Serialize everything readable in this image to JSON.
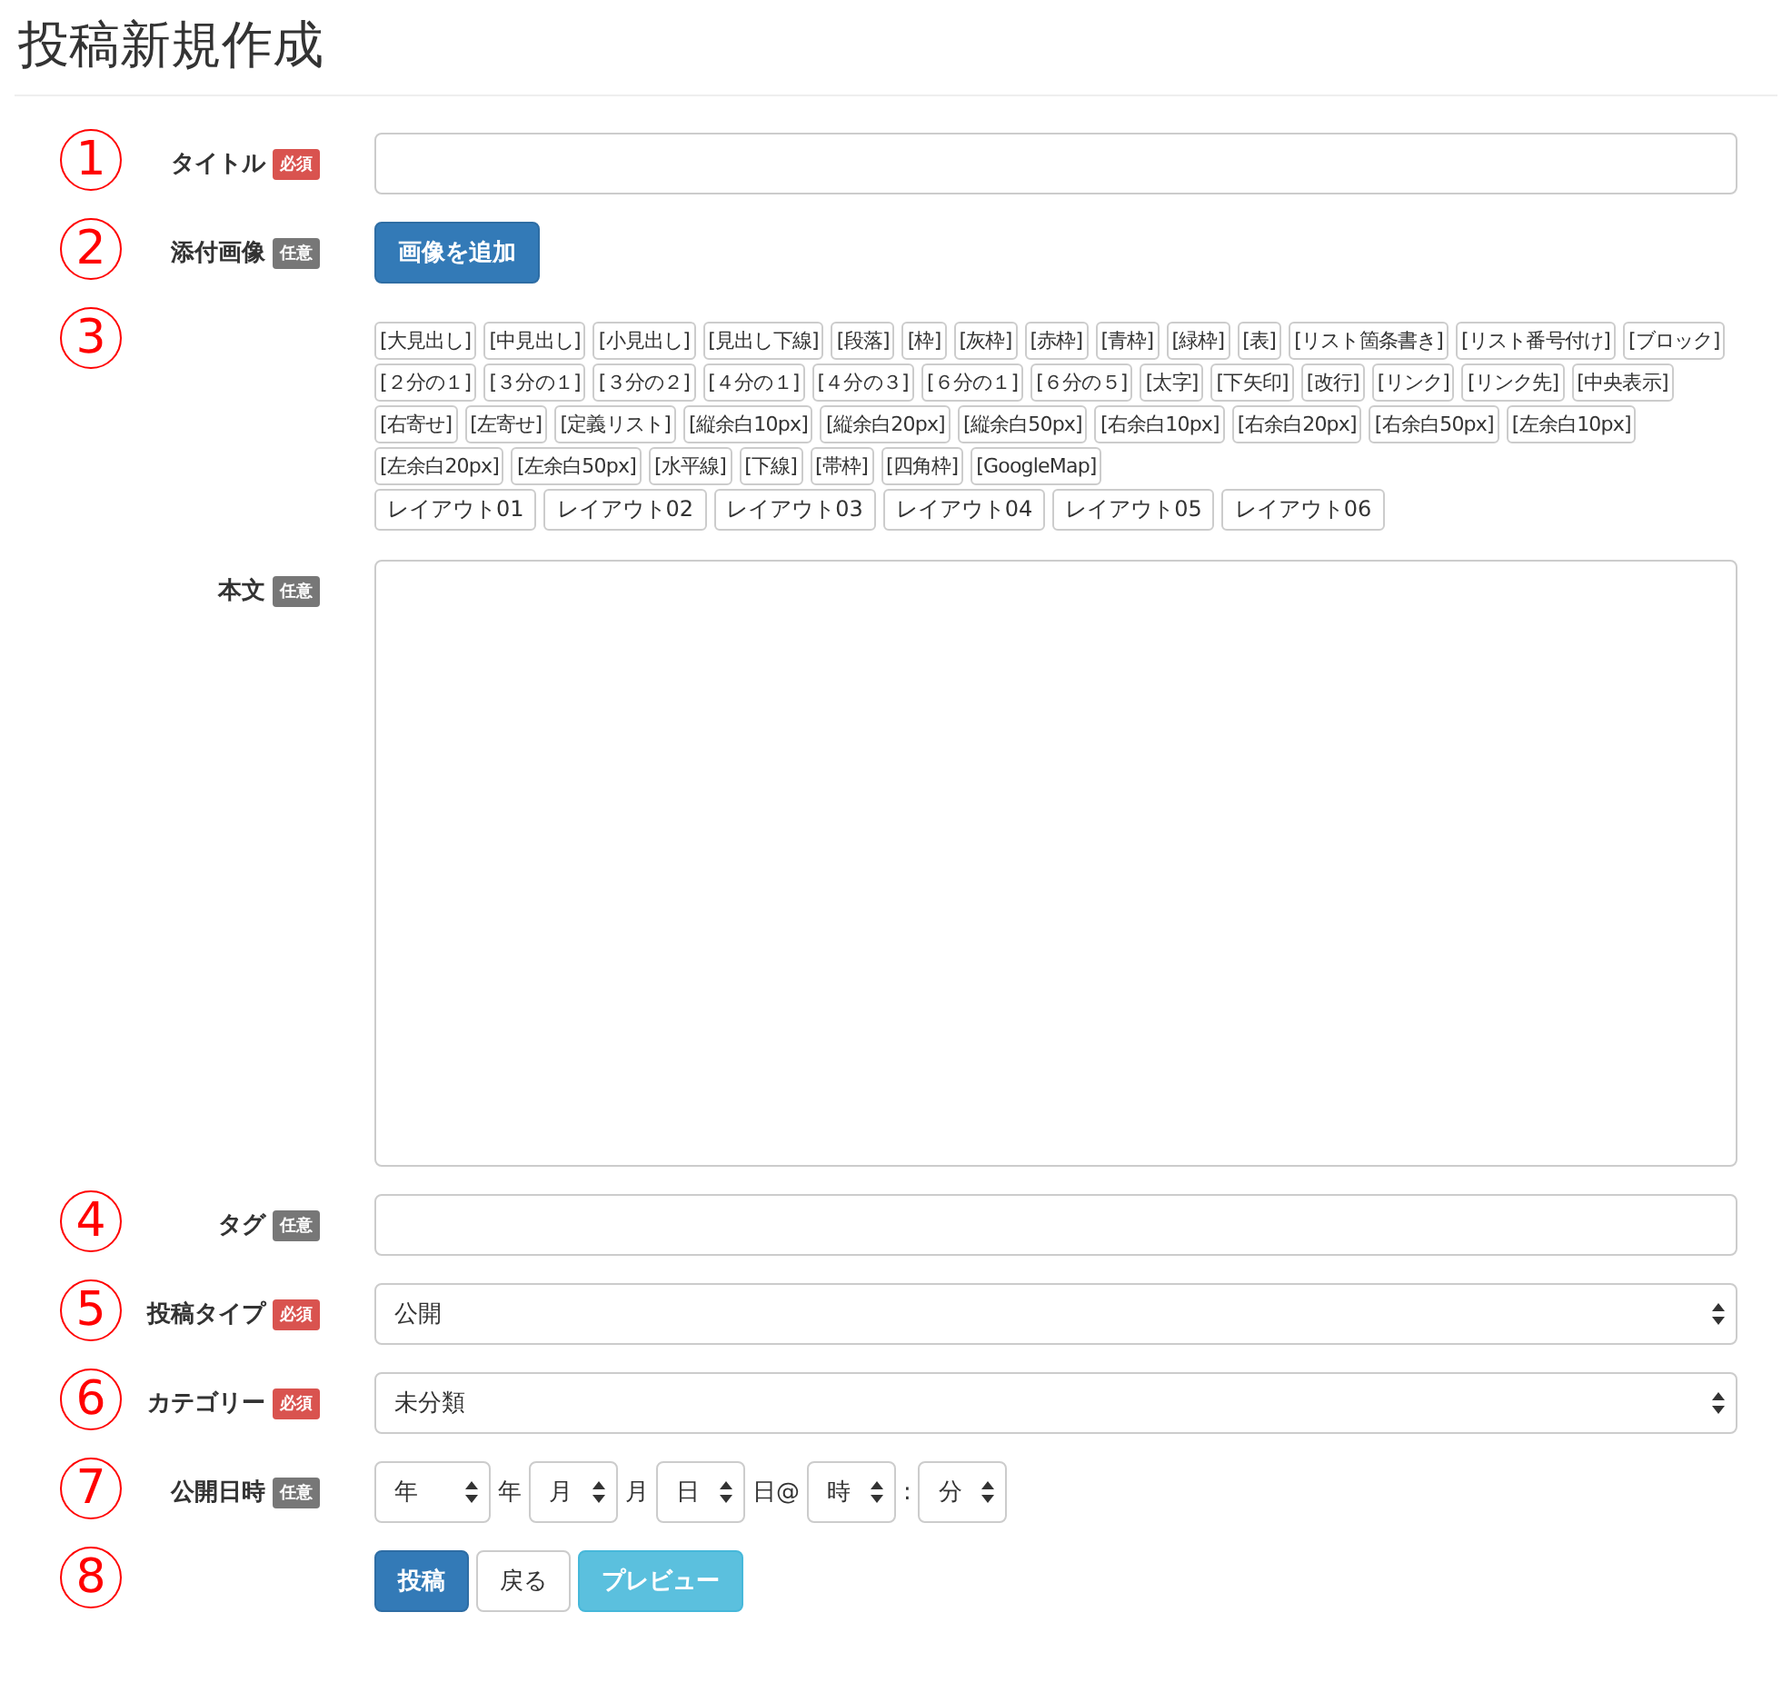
{
  "page_title": "投稿新規作成",
  "rows": [
    {
      "marker": "1",
      "label": "タイトル",
      "badge": {
        "text": "必須",
        "kind": "required"
      },
      "control": {
        "kind": "input"
      }
    },
    {
      "marker": "2",
      "label": "添付画像",
      "badge": {
        "text": "任意",
        "kind": "optional"
      },
      "control": {
        "kind": "button",
        "text": "画像を追加"
      }
    },
    {
      "marker": "3",
      "control": {
        "kind": "snippets",
        "snippets": [
          "[大見出し]",
          "[中見出し]",
          "[小見出し]",
          "[見出し下線]",
          "[段落]",
          "[枠]",
          "[灰枠]",
          "[赤枠]",
          "[青枠]",
          "[緑枠]",
          "[表]",
          "[リスト箇条書き]",
          "[リスト番号付け]",
          "[ブロック]",
          "[２分の１]",
          "[３分の１]",
          "[３分の２]",
          "[４分の１]",
          "[４分の３]",
          "[６分の１]",
          "[６分の５]",
          "[太字]",
          "[下矢印]",
          "[改行]",
          "[リンク]",
          "[リンク先]",
          "[中央表示]",
          "[右寄せ]",
          "[左寄せ]",
          "[定義リスト]",
          "[縦余白10px]",
          "[縦余白20px]",
          "[縦余白50px]",
          "[右余白10px]",
          "[右余白20px]",
          "[右余白50px]",
          "[左余白10px]",
          "[左余白20px]",
          "[左余白50px]",
          "[水平線]",
          "[下線]",
          "[帯枠]",
          "[四角枠]",
          "[GoogleMap]"
        ],
        "layouts": [
          "レイアウト01",
          "レイアウト02",
          "レイアウト03",
          "レイアウト04",
          "レイアウト05",
          "レイアウト06"
        ]
      }
    },
    {
      "label": "本文",
      "badge": {
        "text": "任意",
        "kind": "optional"
      },
      "control": {
        "kind": "textarea"
      }
    },
    {
      "marker": "4",
      "label": "タグ",
      "badge": {
        "text": "任意",
        "kind": "optional"
      },
      "control": {
        "kind": "input"
      }
    },
    {
      "marker": "5",
      "label": "投稿タイプ",
      "badge": {
        "text": "必須",
        "kind": "required"
      },
      "control": {
        "kind": "select",
        "value": "公開"
      }
    },
    {
      "marker": "6",
      "label": "カテゴリー",
      "badge": {
        "text": "必須",
        "kind": "required"
      },
      "control": {
        "kind": "select",
        "value": "未分類"
      }
    },
    {
      "marker": "7",
      "label": "公開日時",
      "badge": {
        "text": "任意",
        "kind": "optional"
      },
      "control": {
        "kind": "datetime",
        "parts": [
          {
            "kind": "wideselect",
            "value": "年"
          },
          {
            "kind": "text",
            "text": "年"
          },
          {
            "kind": "select",
            "value": "月"
          },
          {
            "kind": "text",
            "text": "月"
          },
          {
            "kind": "select",
            "value": "日"
          },
          {
            "kind": "text",
            "text": "日@"
          },
          {
            "kind": "select",
            "value": "時"
          },
          {
            "kind": "text",
            "text": ":"
          },
          {
            "kind": "select",
            "value": "分"
          }
        ]
      }
    },
    {
      "marker": "8",
      "control": {
        "kind": "actions",
        "buttons": [
          {
            "text": "投稿",
            "kind": "primary"
          },
          {
            "text": "戻る",
            "kind": "default"
          },
          {
            "text": "プレビュー",
            "kind": "info"
          }
        ]
      }
    }
  ]
}
